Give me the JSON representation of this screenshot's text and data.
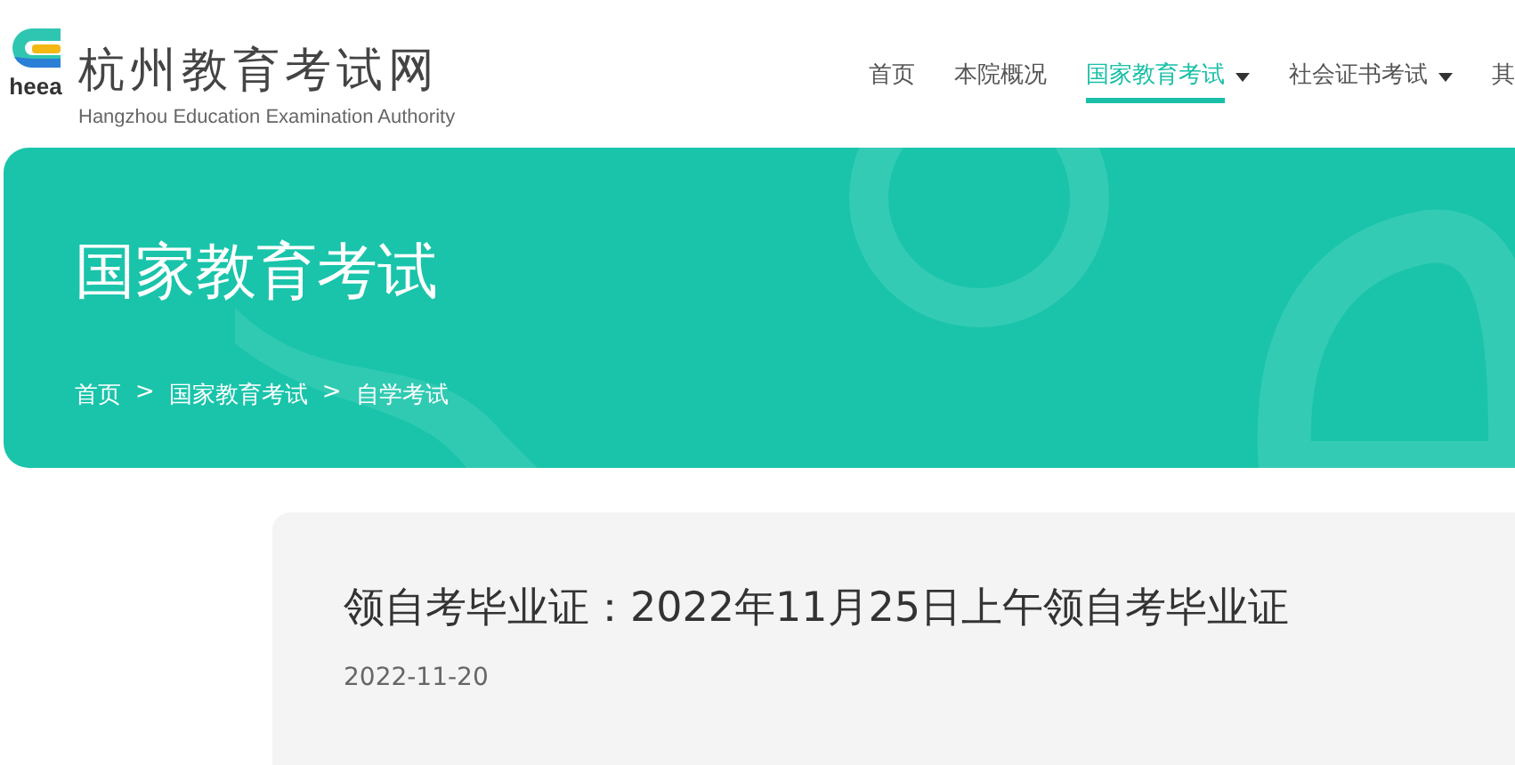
{
  "logo": {
    "mark": "heea",
    "title": "杭州教育考试网",
    "subtitle": "Hangzhou Education Examination Authority"
  },
  "nav": [
    {
      "label": "首页",
      "selected": false,
      "dropdown": false
    },
    {
      "label": "本院概况",
      "selected": false,
      "dropdown": false
    },
    {
      "label": "国家教育考试",
      "selected": true,
      "dropdown": true
    },
    {
      "label": "社会证书考试",
      "selected": false,
      "dropdown": true
    },
    {
      "label": "其",
      "selected": false,
      "dropdown": false
    }
  ],
  "banner": {
    "title": "国家教育考试",
    "breadcrumb": {
      "separator": ">",
      "items": [
        "首页",
        "国家教育考试",
        "自学考试"
      ]
    }
  },
  "article": {
    "title": "领自考毕业证：2022年11月25日上午领自考毕业证",
    "date": "2022-11-20"
  }
}
